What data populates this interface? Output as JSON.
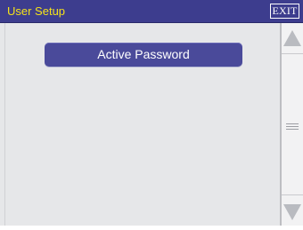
{
  "titlebar": {
    "title": "User Setup",
    "exit_label": "EXIT"
  },
  "main": {
    "buttons": [
      {
        "label": "Active Password"
      }
    ]
  },
  "scrollbar": {
    "up_icon": "triangle-up-icon",
    "down_icon": "triangle-down-icon",
    "grip_icon": "grip-icon"
  },
  "colors": {
    "titlebar_bg": "#3d3d8e",
    "title_text": "#f5e21a",
    "button_bg": "#4a4a9a",
    "background": "#e6e7e9"
  }
}
